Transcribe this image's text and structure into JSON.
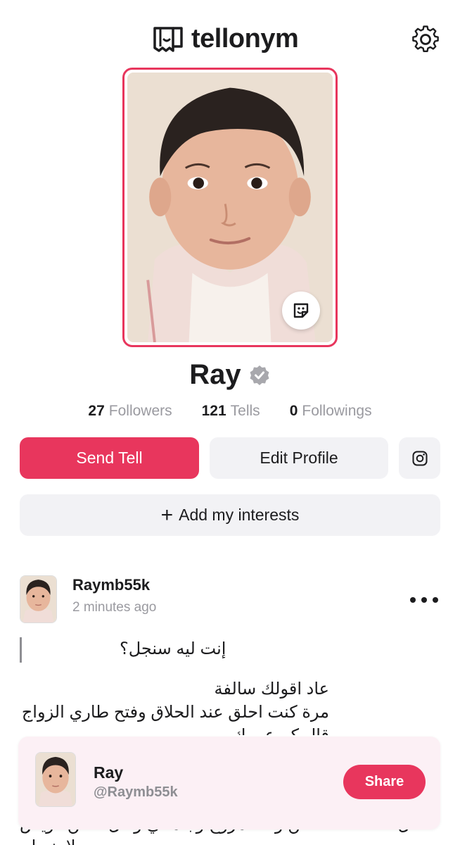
{
  "header": {
    "app_name": "tellonym",
    "logo_icon": "tellonym-logo-icon",
    "settings_icon": "gear-icon"
  },
  "profile": {
    "name": "Ray",
    "verified_icon": "verified-badge-icon",
    "stats": [
      {
        "value": "27",
        "label": "Followers"
      },
      {
        "value": "121",
        "label": "Tells"
      },
      {
        "value": "0",
        "label": "Followings"
      }
    ]
  },
  "actions": {
    "send_tell": "Send Tell",
    "edit_profile": "Edit Profile",
    "instagram_icon": "instagram-icon",
    "add_interests": "Add my interests",
    "plus_symbol": "+"
  },
  "post": {
    "username": "Raymb55k",
    "time": "2 minutes ago",
    "question": "إنت ليه سنجل؟",
    "answer_lines": [
      "عاد اقولك سالفة",
      "مرة كنت احلق عند الحلاق وفتح طاري الزواج",
      "قال كم عمرك"
    ],
    "answer_bottom_lines": [
      "قال انا سكنت سكن واحد مزوج وجاملني وقال سكن كويس",
      "ولا ينسلم"
    ]
  },
  "share_card": {
    "name": "Ray",
    "handle": "@Raymb55k",
    "share_label": "Share"
  },
  "colors": {
    "accent": "#e8365d",
    "button_bg": "#f2f2f5",
    "muted_text": "#9a9aa0",
    "card_bg": "#fcf0f5"
  }
}
